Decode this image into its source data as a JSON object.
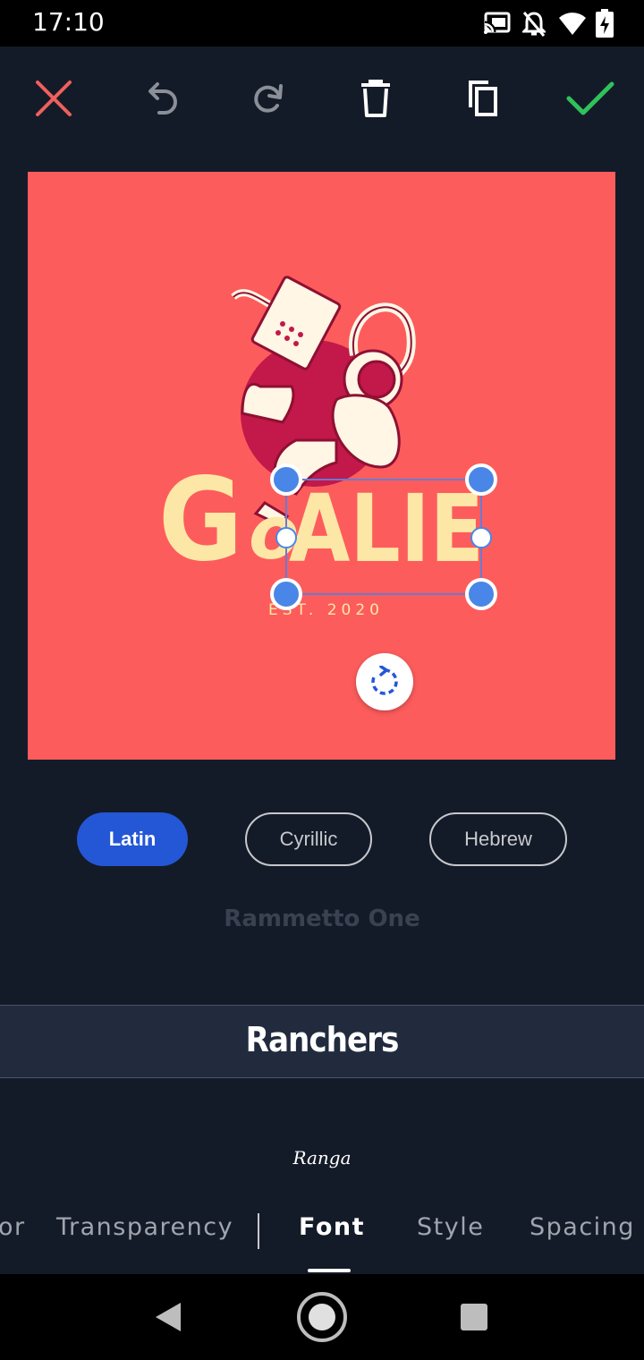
{
  "status_bar": {
    "time": "17:10"
  },
  "toolbar": {
    "icons": [
      "close-icon",
      "undo-icon",
      "redo-icon",
      "delete-icon",
      "duplicate-icon",
      "confirm-icon"
    ]
  },
  "canvas": {
    "background_color": "#fd5c5c",
    "logo_letter_g": "G",
    "logo_letter_o": "o",
    "logo_text_alie": "ALIE",
    "logo_subtitle": "EST. 2020"
  },
  "script_filters": [
    {
      "label": "Latin",
      "selected": true
    },
    {
      "label": "Cyrillic",
      "selected": false
    },
    {
      "label": "Hebrew",
      "selected": false
    }
  ],
  "font_picker": {
    "previous": "Rammetto One",
    "selected": "Ranchers",
    "next": "Ranga"
  },
  "tabs": [
    {
      "label": "or",
      "active": false
    },
    {
      "label": "Transparency",
      "active": false
    },
    {
      "label": "Font",
      "active": true
    },
    {
      "label": "Style",
      "active": false
    },
    {
      "label": "Spacing",
      "active": false
    }
  ],
  "colors": {
    "accent_blue": "#2457d6",
    "handle_blue": "#4a86e8",
    "close_red": "#f0605d",
    "confirm_green": "#2fc25b",
    "logo_cream": "#fde7a6"
  }
}
